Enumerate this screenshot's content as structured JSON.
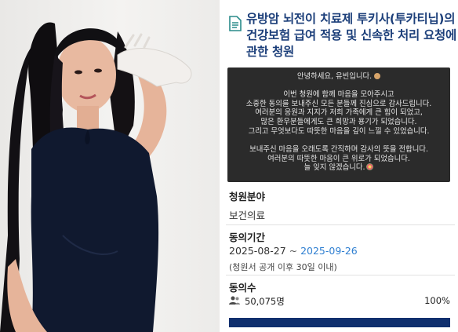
{
  "petition": {
    "title": "유방암 뇌전이 치료제 투키사(투카티닙)의 건강보험 급여 적용 및 신속한 처리 요청에 관한 청원",
    "message_lines": [
      "안녕하세요, 유빈입니다.",
      "",
      "이번 청원에 함께 마음을 모아주시고",
      "소중한 동의를 보내주신 모든 분들께 진심으로 감사드립니다.",
      "여러분의 응원과 지지가 저희 가족에게 큰 힘이 되었고,",
      "많은 환우분들에게도 큰 희망과 용기가 되었습니다.",
      "그리고 무엇보다도 따뜻한 마음을 깊이 느낄 수 있었습니다.",
      "",
      "보내주신 마음을 오래도록 간직하며 감사의 뜻을 전합니다.",
      "여러분의 따뜻한 마음이 큰 위로가 되었습니다.",
      "늘 잊지 않겠습니다."
    ],
    "field_label": "청원분야",
    "field_value": "보건의료",
    "period_label": "동의기간",
    "period_start": "2025-08-27",
    "period_sep": " ~ ",
    "period_end": "2025-09-26",
    "period_note": "(청원서 공개 이후 30일 이내)",
    "count_label": "동의수",
    "count_value": "50,075명",
    "percent_text": "100%",
    "progress_fraction": 1.0
  },
  "colors": {
    "title": "#1c3f7a",
    "date_accent": "#2f7fd1",
    "progress": "#0f2f6e",
    "message_bg": "#2b2b2b"
  },
  "icons": [
    "document-icon",
    "people-icon"
  ]
}
